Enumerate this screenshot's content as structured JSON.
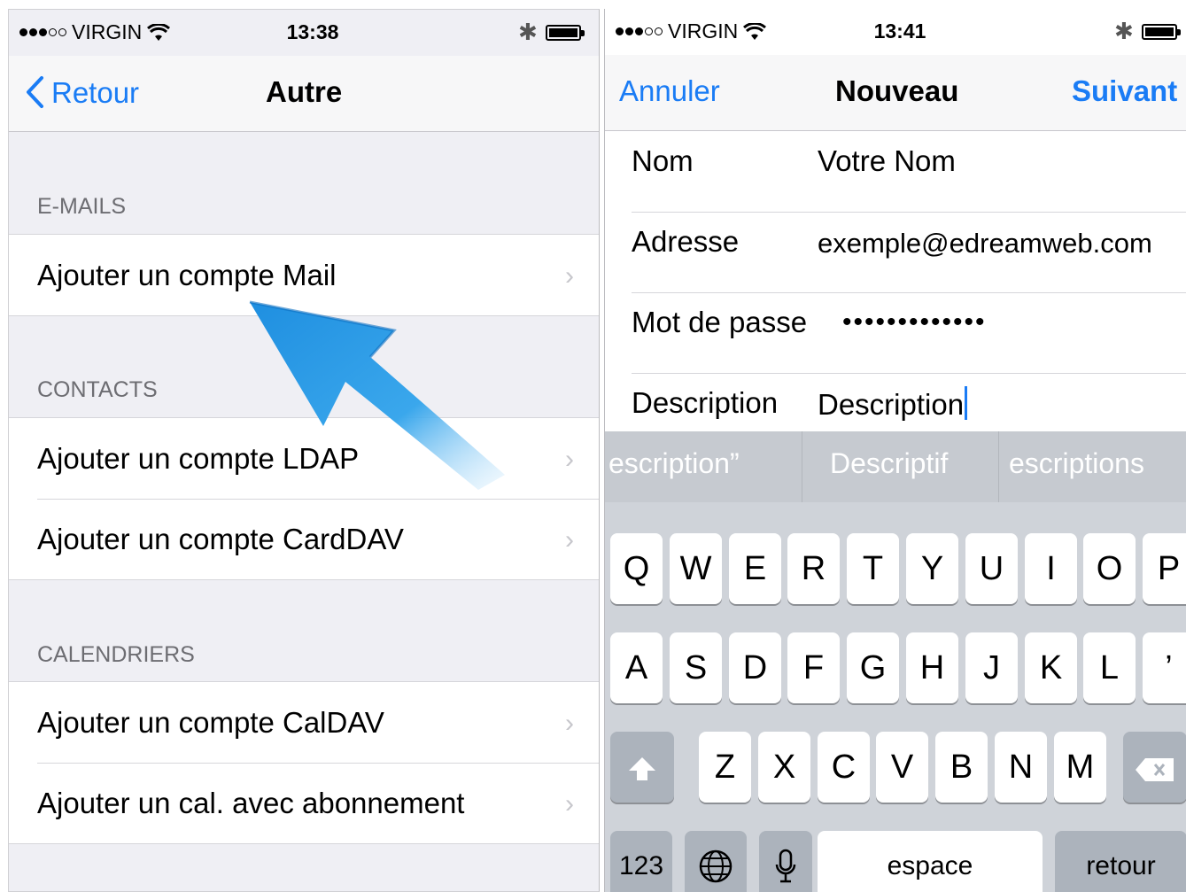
{
  "left": {
    "status": {
      "carrier": "VIRGIN",
      "time": "13:38"
    },
    "nav": {
      "back_label": "Retour",
      "title": "Autre"
    },
    "sections": [
      {
        "header": "E-MAILS",
        "items": [
          "Ajouter un compte Mail"
        ]
      },
      {
        "header": "CONTACTS",
        "items": [
          "Ajouter un compte LDAP",
          "Ajouter un compte CardDAV"
        ]
      },
      {
        "header": "CALENDRIERS",
        "items": [
          "Ajouter un compte CalDAV",
          "Ajouter un cal. avec abonnement"
        ]
      }
    ]
  },
  "right": {
    "status": {
      "carrier": "VIRGIN",
      "time": "13:41"
    },
    "nav": {
      "cancel_label": "Annuler",
      "title": "Nouveau",
      "next_label": "Suivant"
    },
    "form": [
      {
        "label": "Nom",
        "value": "Votre Nom"
      },
      {
        "label": "Adresse",
        "value": "exemple@edreamweb.com"
      },
      {
        "label": "Mot de passe",
        "value": "•••••••••••••"
      },
      {
        "label": "Description",
        "value": "Description"
      }
    ],
    "predictions": [
      "escription”",
      "Descriptif",
      "escriptions"
    ],
    "keyboard": {
      "row1": [
        "Q",
        "W",
        "E",
        "R",
        "T",
        "Y",
        "U",
        "I",
        "O",
        "P"
      ],
      "row2": [
        "A",
        "S",
        "D",
        "F",
        "G",
        "H",
        "J",
        "K",
        "L",
        "’"
      ],
      "row3": [
        "Z",
        "X",
        "C",
        "V",
        "B",
        "N",
        "M"
      ],
      "numbers_label": "123",
      "space_label": "espace",
      "return_label": "retour"
    }
  },
  "colors": {
    "accent": "#1a7cf5",
    "arrow": "#2a9be0"
  }
}
